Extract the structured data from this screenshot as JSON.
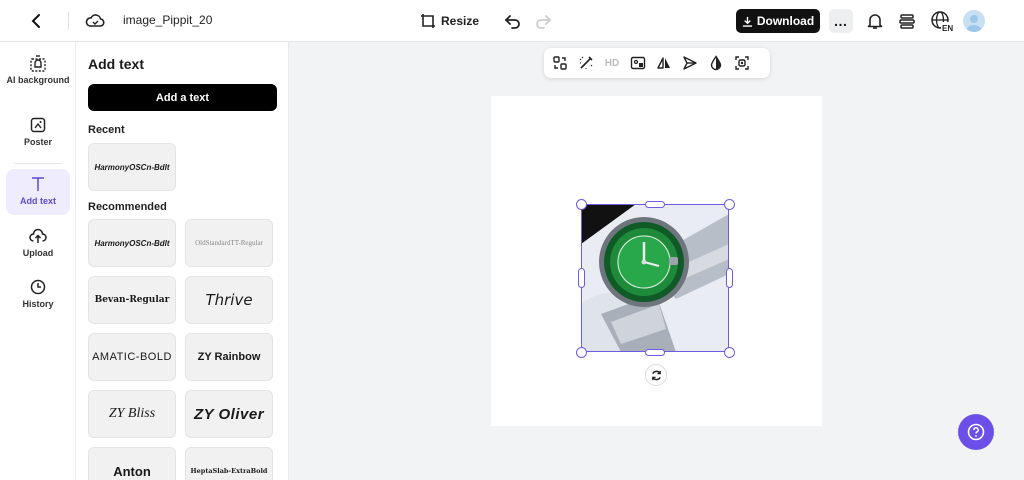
{
  "header": {
    "file_name": "image_Pippit_20",
    "resize_label": "Resize",
    "download_label": "Download",
    "more_label": "…",
    "lang_code": "EN"
  },
  "nav": {
    "items": [
      {
        "label": "AI background",
        "icon": "ai-background-icon"
      },
      {
        "label": "Poster",
        "icon": "poster-icon"
      },
      {
        "label": "Add text",
        "icon": "text-icon",
        "active": true
      },
      {
        "label": "Upload",
        "icon": "upload-icon"
      },
      {
        "label": "History",
        "icon": "history-icon"
      }
    ]
  },
  "panel": {
    "title": "Add text",
    "add_button": "Add a text",
    "recent_title": "Recent",
    "recommended_title": "Recommended",
    "recent_fonts": [
      "HarmonyOSCn-Bdlt"
    ],
    "recommended_fonts": [
      "HarmonyOSCn-Bdlt",
      "OldStandardTT-Regular",
      "Bevan-Regular",
      "Thrive",
      "AMATIC-BOLD",
      "ZY Rainbow",
      "ZY Bliss",
      "ZY Oliver",
      "Anton",
      "HeptaSlab-ExtraBold"
    ]
  },
  "toolbar": {
    "hd_label": "HD"
  },
  "colors": {
    "accent": "#6d5be0",
    "help": "#6b4fe6",
    "watch_dial": "#1e8a3a"
  }
}
